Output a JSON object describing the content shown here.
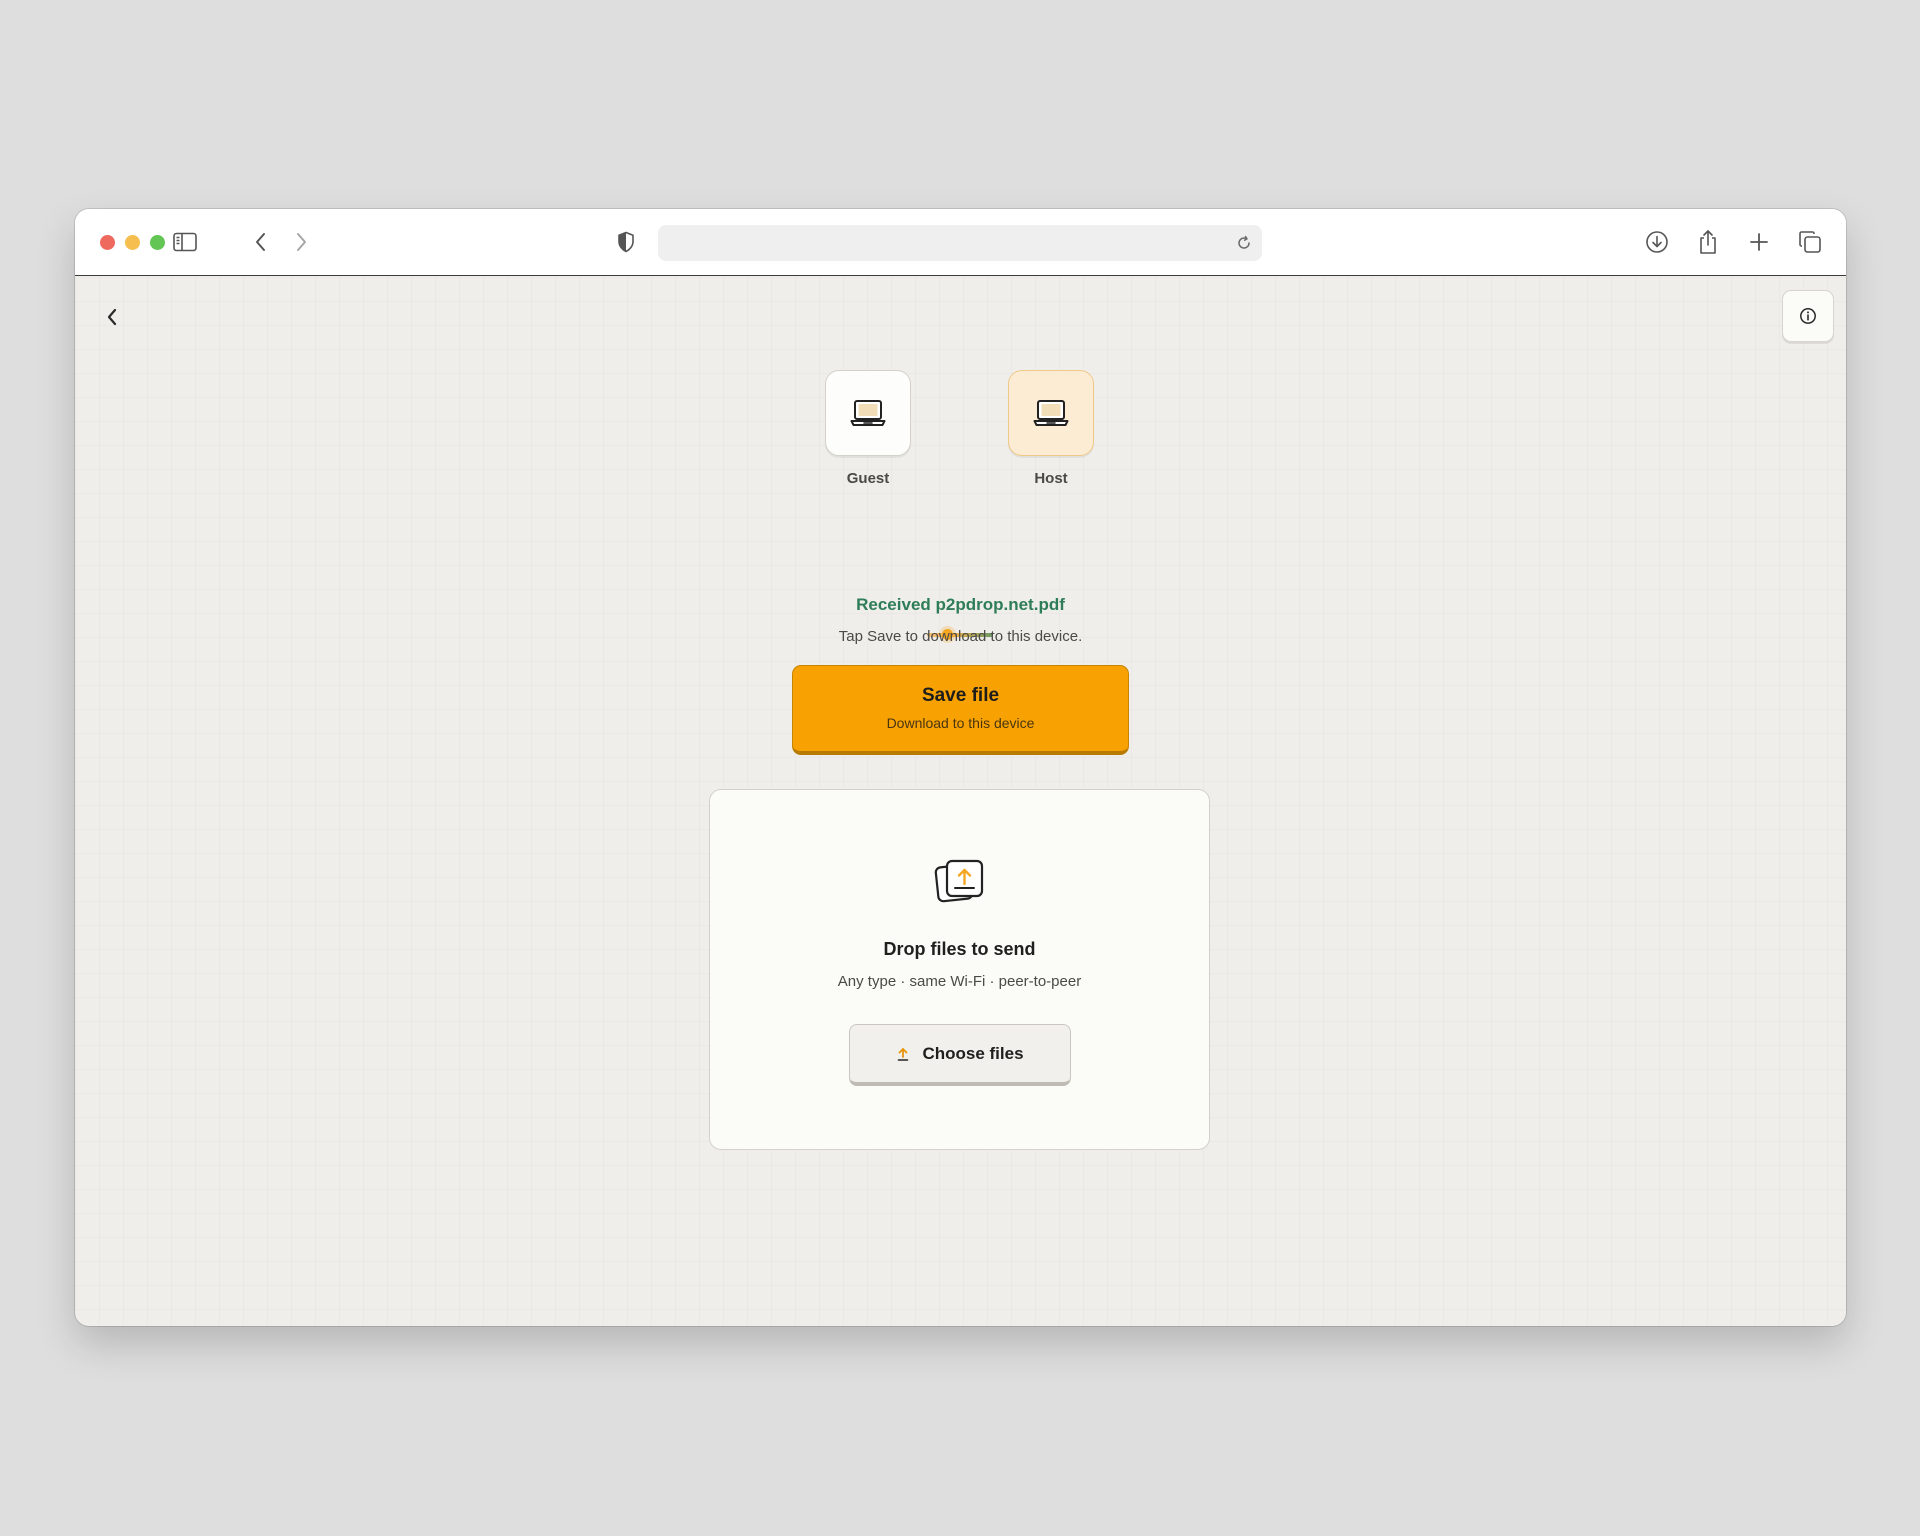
{
  "browser": {
    "url": "",
    "icons": {
      "sidebar": "sidebar-icon",
      "back": "chevron-left-icon",
      "forward": "chevron-right-icon",
      "privacy": "shield-icon",
      "reload": "reload-icon",
      "downloads": "download-icon",
      "share": "share-icon",
      "new_tab": "plus-icon",
      "tabs": "tabs-overview-icon"
    }
  },
  "page": {
    "peers": {
      "guest": {
        "label": "Guest",
        "icon": "laptop-icon"
      },
      "host": {
        "label": "Host",
        "icon": "laptop-icon"
      }
    },
    "status": {
      "received": "Received p2pdrop.net.pdf",
      "hint": "Tap Save to download to this device."
    },
    "save_button": {
      "title": "Save file",
      "subtitle": "Download to this device"
    },
    "dropzone": {
      "title": "Drop files to send",
      "subtitle": "Any type · same Wi‑Fi · peer‑to‑peer",
      "button_label": "Choose files"
    }
  },
  "colors": {
    "accent": "#f7a202",
    "success_text": "#2f7d58",
    "host_tile": "#fcecd3",
    "background": "#efeeea"
  }
}
